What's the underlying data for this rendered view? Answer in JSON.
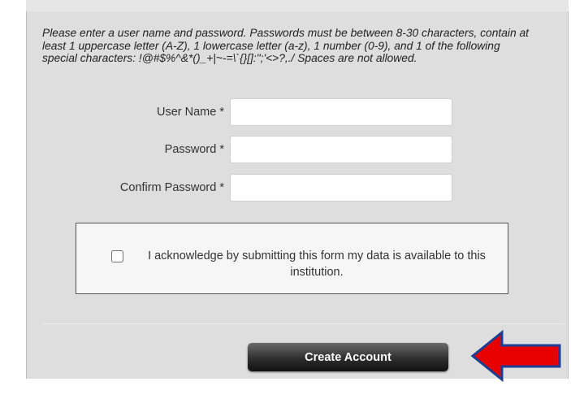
{
  "form": {
    "instructions": "Please enter a user name and password. Passwords must be between 8-30 characters, contain at least 1 uppercase letter (A-Z), 1 lowercase letter (a-z), 1 number (0-9), and 1 of the following special characters: !@#$%^&*()_+|~-=\\`{}[]:\";'<>?,./ Spaces are not allowed.",
    "fields": {
      "username": {
        "label": "User Name *",
        "value": ""
      },
      "password": {
        "label": "Password *",
        "value": ""
      },
      "confirm": {
        "label": "Confirm Password *",
        "value": ""
      }
    },
    "acknowledge": {
      "text": "I acknowledge by submitting this form my data is available to this institution.",
      "checked": false
    },
    "submit_label": "Create Account"
  },
  "annotation": {
    "arrow_color": "#e60000",
    "arrow_outline": "#1c3f94",
    "arrow_icon": "left-arrow-icon"
  }
}
